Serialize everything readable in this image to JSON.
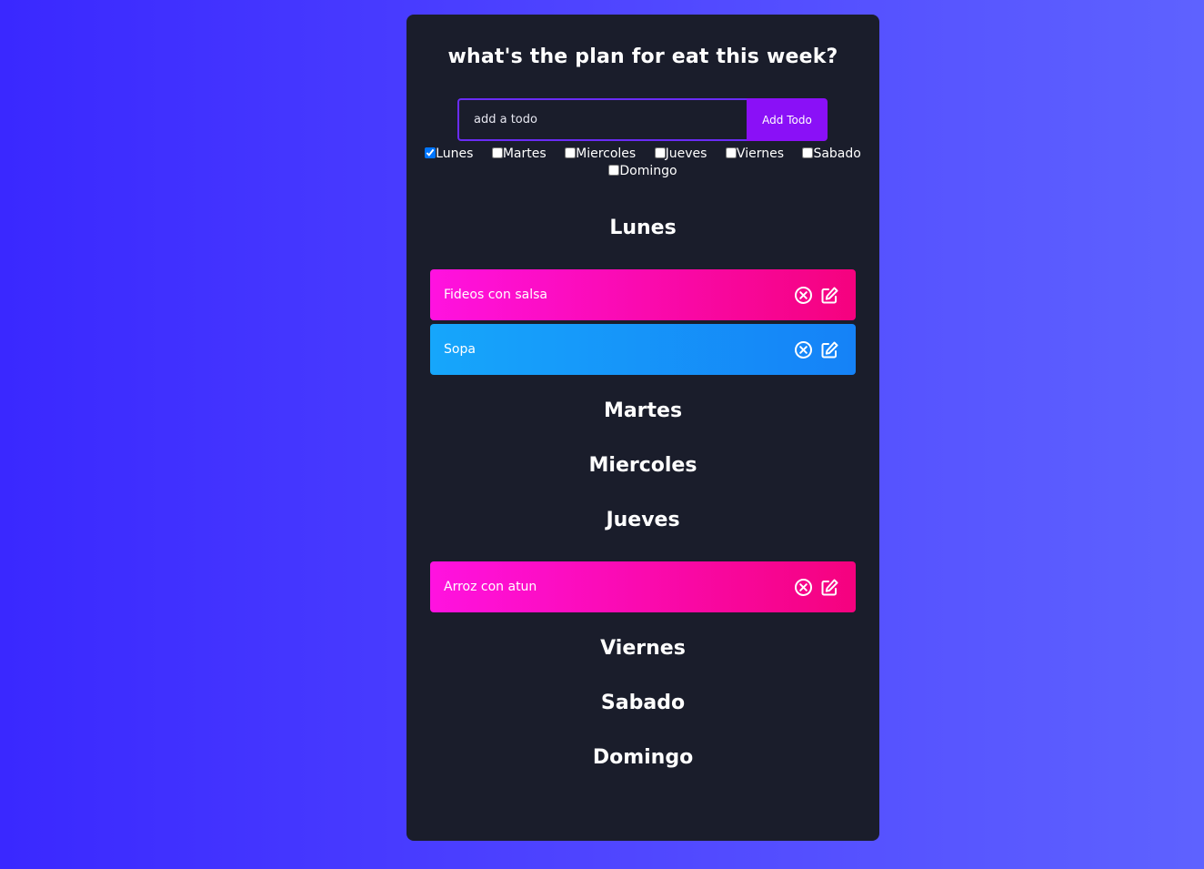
{
  "header": {
    "title": "what's the plan for eat this week?"
  },
  "form": {
    "placeholder": "add a todo",
    "value": "",
    "add_label": "Add Todo"
  },
  "days_filter": [
    {
      "label": "Lunes",
      "checked": true
    },
    {
      "label": "Martes",
      "checked": false
    },
    {
      "label": "Miercoles",
      "checked": false
    },
    {
      "label": "Jueves",
      "checked": false
    },
    {
      "label": "Viernes",
      "checked": false
    },
    {
      "label": "Sabado",
      "checked": false
    },
    {
      "label": "Domingo",
      "checked": false
    }
  ],
  "sections": {
    "lunes": {
      "heading": "Lunes",
      "todos": [
        {
          "text": "Fideos con salsa",
          "color": "pink"
        },
        {
          "text": "Sopa",
          "color": "blue"
        }
      ]
    },
    "martes": {
      "heading": "Martes"
    },
    "miercoles": {
      "heading": "Miercoles"
    },
    "jueves": {
      "heading": "Jueves",
      "todos": [
        {
          "text": "Arroz con atun",
          "color": "pink"
        }
      ]
    },
    "viernes": {
      "heading": "Viernes"
    },
    "sabado": {
      "heading": "Sabado"
    },
    "domingo": {
      "heading": "Domingo"
    }
  },
  "icons": {
    "delete": "close-circle-icon",
    "edit": "edit-icon"
  },
  "colors": {
    "pink_start": "#ff12e0",
    "pink_end": "#f5027e",
    "blue_start": "#16a6fb",
    "blue_end": "#1582f7",
    "panel": "#1a1d2b",
    "button": "#8a10f7"
  }
}
